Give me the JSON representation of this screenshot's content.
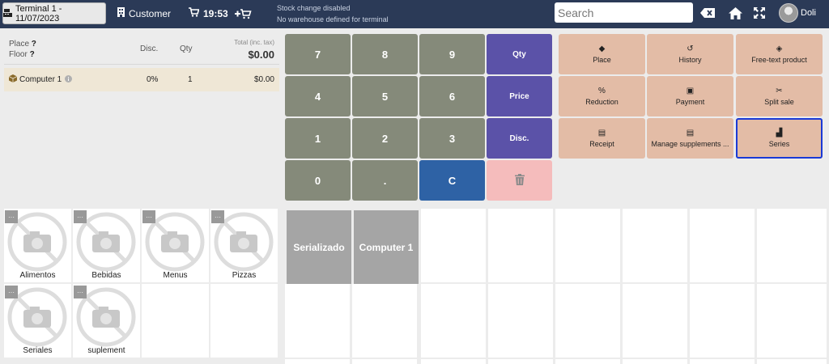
{
  "topbar": {
    "terminal_label": "Terminal 1 - 11/07/2023",
    "customer_label": "Customer",
    "time": "19:53",
    "stock_line1": "Stock change disabled",
    "stock_line2": "No warehouse defined for terminal",
    "search_placeholder": "Search",
    "user_name": "Doli",
    "icons": [
      "terminal-icon",
      "customer-icon",
      "cart-icon",
      "add-cart-icon",
      "clear-search-icon",
      "home-icon",
      "fullscreen-icon"
    ]
  },
  "order": {
    "place_label": "Place",
    "place_value": "?",
    "floor_label": "Floor",
    "floor_value": "?",
    "disc_header": "Disc.",
    "qty_header": "Qty",
    "total_header": "Total (inc. tax)",
    "total_value": "$0.00",
    "lines": [
      {
        "name": "Computer 1",
        "disc": "0%",
        "qty": "1",
        "total": "$0.00"
      }
    ]
  },
  "numpad": {
    "keys": [
      "7",
      "8",
      "9",
      "4",
      "5",
      "6",
      "1",
      "2",
      "3",
      "0",
      "."
    ],
    "qty_label": "Qty",
    "price_label": "Price",
    "disc_label": "Disc.",
    "clear_label": "C"
  },
  "actions": [
    {
      "label": "Place",
      "icon": "layers-icon",
      "glyph": "◆"
    },
    {
      "label": "History",
      "icon": "history-icon",
      "glyph": "↺"
    },
    {
      "label": "Free-text product",
      "icon": "box-icon",
      "glyph": "◈"
    },
    {
      "label": "Reduction",
      "icon": "percent-icon",
      "glyph": "%"
    },
    {
      "label": "Payment",
      "icon": "money-icon",
      "glyph": "▣"
    },
    {
      "label": "Split sale",
      "icon": "scissors-icon",
      "glyph": "✂"
    },
    {
      "label": "Receipt",
      "icon": "receipt-icon",
      "glyph": "▤"
    },
    {
      "label": "Manage supplements ...",
      "icon": "list-icon",
      "glyph": "▤"
    },
    {
      "label": "Series",
      "icon": "series-icon",
      "glyph": "▟"
    }
  ],
  "selected_action": "Series",
  "categories": [
    {
      "label": "Alimentos"
    },
    {
      "label": "Bebidas"
    },
    {
      "label": "Menus"
    },
    {
      "label": "Pizzas"
    },
    {
      "label": "Seriales"
    },
    {
      "label": "suplement"
    }
  ],
  "products": [
    {
      "label": "Serializado"
    },
    {
      "label": "Computer 1"
    }
  ],
  "colors": {
    "topbar": "#2b3a57",
    "numkey": "#858a7a",
    "modekey": "#5b52a8",
    "clearkey": "#2e62a5",
    "deletekey": "#f5bcbc",
    "action": "#e3bca6",
    "selected_outline": "#1a3ad6",
    "product_filled": "#a5a5a5",
    "order_line": "#efe7d6"
  }
}
